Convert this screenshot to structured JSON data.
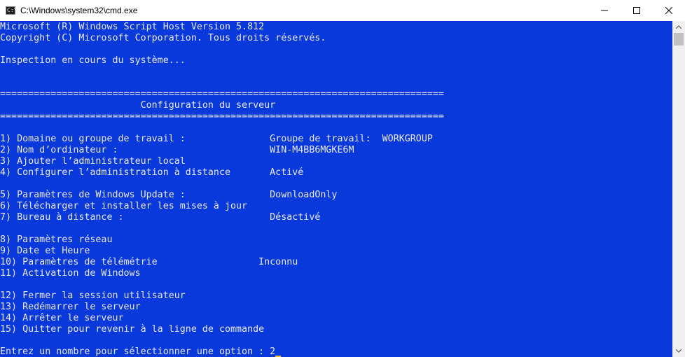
{
  "window": {
    "title": "C:\\Windows\\system32\\cmd.exe",
    "app_icon_text": "C:\\"
  },
  "colors": {
    "console_bg": "#0a39db",
    "console_fg": "#e8e8e8",
    "cursor": "#f0c419"
  },
  "console": {
    "lines": [
      "Microsoft (R) Windows Script Host Version 5.812",
      "Copyright (C) Microsoft Corporation. Tous droits réservés.",
      "",
      "Inspection en cours du système...",
      "",
      "",
      "===============================================================================",
      "                         Configuration du serveur",
      "===============================================================================",
      "",
      "1) Domaine ou groupe de travail :               Groupe de travail:  WORKGROUP",
      "2) Nom d’ordinateur :                           WIN-M4BB6MGKE6M",
      "3) Ajouter l’administrateur local",
      "4) Configurer l’administration à distance       Activé",
      "",
      "5) Paramètres de Windows Update :               DownloadOnly",
      "6) Télécharger et installer les mises à jour",
      "7) Bureau à distance :                          Désactivé",
      "",
      "8) Paramètres réseau",
      "9) Date et Heure",
      "10) Paramètres de télémétrie                  Inconnu",
      "11) Activation de Windows",
      "",
      "12) Fermer la session utilisateur",
      "13) Redémarrer le serveur",
      "14) Arrêter le serveur",
      "15) Quitter pour revenir à la ligne de commande",
      "",
      "Entrez un nombre pour sélectionner une option : 2"
    ]
  }
}
